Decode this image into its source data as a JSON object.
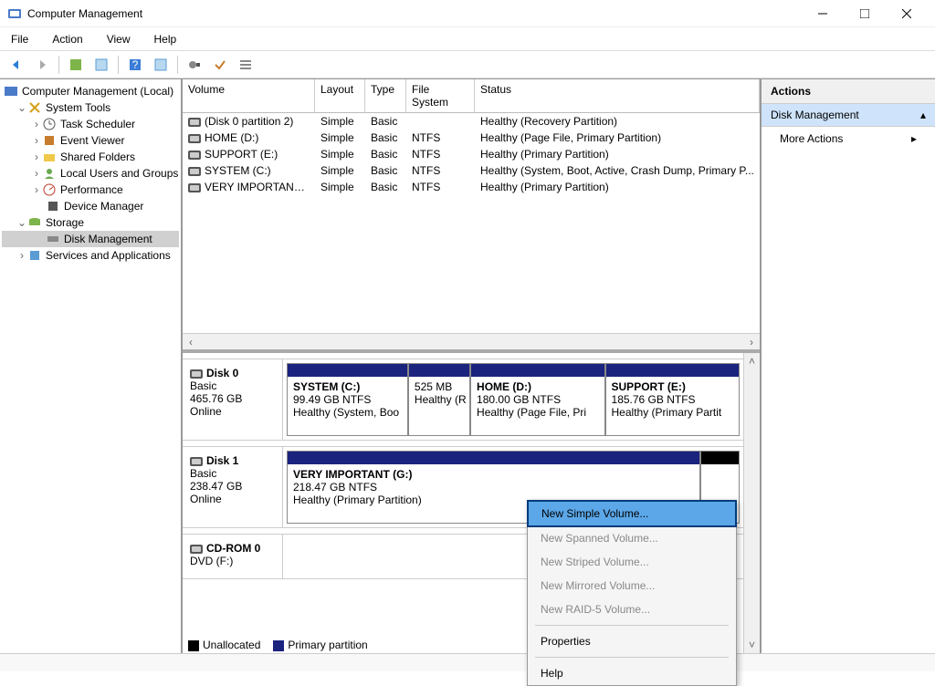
{
  "window": {
    "title": "Computer Management"
  },
  "menubar": {
    "file": "File",
    "action": "Action",
    "view": "View",
    "help": "Help"
  },
  "tree": {
    "root": "Computer Management (Local)",
    "system_tools": "System Tools",
    "task_scheduler": "Task Scheduler",
    "event_viewer": "Event Viewer",
    "shared_folders": "Shared Folders",
    "local_users": "Local Users and Groups",
    "performance": "Performance",
    "device_manager": "Device Manager",
    "storage": "Storage",
    "disk_management": "Disk Management",
    "services": "Services and Applications"
  },
  "volume_table": {
    "headers": {
      "volume": "Volume",
      "layout": "Layout",
      "type": "Type",
      "fs": "File System",
      "status": "Status"
    },
    "rows": [
      {
        "volume": "(Disk 0 partition 2)",
        "layout": "Simple",
        "type": "Basic",
        "fs": "",
        "status": "Healthy (Recovery Partition)"
      },
      {
        "volume": "HOME (D:)",
        "layout": "Simple",
        "type": "Basic",
        "fs": "NTFS",
        "status": "Healthy (Page File, Primary Partition)"
      },
      {
        "volume": "SUPPORT (E:)",
        "layout": "Simple",
        "type": "Basic",
        "fs": "NTFS",
        "status": "Healthy (Primary Partition)"
      },
      {
        "volume": "SYSTEM (C:)",
        "layout": "Simple",
        "type": "Basic",
        "fs": "NTFS",
        "status": "Healthy (System, Boot, Active, Crash Dump, Primary P..."
      },
      {
        "volume": "VERY IMPORTANT (G:)",
        "layout": "Simple",
        "type": "Basic",
        "fs": "NTFS",
        "status": "Healthy (Primary Partition)"
      }
    ]
  },
  "disks": {
    "d0": {
      "name": "Disk 0",
      "type": "Basic",
      "size": "465.76 GB",
      "state": "Online"
    },
    "d0p0": {
      "name": "SYSTEM  (C:)",
      "line2": "99.49 GB NTFS",
      "line3": "Healthy (System, Boo"
    },
    "d0p1": {
      "name": "",
      "line2": "525 MB",
      "line3": "Healthy (R"
    },
    "d0p2": {
      "name": "HOME  (D:)",
      "line2": "180.00 GB NTFS",
      "line3": "Healthy (Page File, Pri"
    },
    "d0p3": {
      "name": "SUPPORT  (E:)",
      "line2": "185.76 GB NTFS",
      "line3": "Healthy (Primary Partit"
    },
    "d1": {
      "name": "Disk 1",
      "type": "Basic",
      "size": "238.47 GB",
      "state": "Online"
    },
    "d1p0": {
      "name": "VERY IMPORTANT  (G:)",
      "line2": "218.47 GB NTFS",
      "line3": "Healthy (Primary Partition)"
    },
    "cd": {
      "name": "CD-ROM 0",
      "type": "DVD (F:)"
    }
  },
  "legend": {
    "unallocated": "Unallocated",
    "primary": "Primary partition"
  },
  "actions": {
    "header": "Actions",
    "section": "Disk Management",
    "more": "More Actions"
  },
  "context_menu": {
    "new_simple": "New Simple Volume...",
    "new_spanned": "New Spanned Volume...",
    "new_striped": "New Striped Volume...",
    "new_mirrored": "New Mirrored Volume...",
    "new_raid5": "New RAID-5 Volume...",
    "properties": "Properties",
    "help": "Help"
  }
}
